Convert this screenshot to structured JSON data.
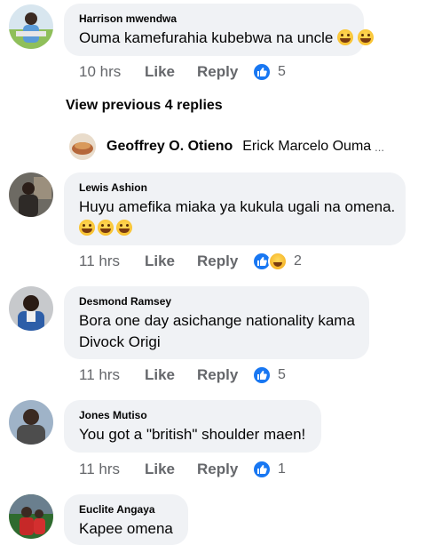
{
  "comments": [
    {
      "author": "Harrison mwendwa",
      "text": "Ouma kamefurahia kubebwa na uncle",
      "time": "10 hrs",
      "like": "Like",
      "reply": "Reply",
      "reactions": "5"
    },
    {
      "author": "Lewis Ashion",
      "text": "Huyu amefika miaka ya kukula ugali na omena.",
      "time": "11 hrs",
      "like": "Like",
      "reply": "Reply",
      "reactions": "2"
    },
    {
      "author": "Desmond Ramsey",
      "text_line1": "Bora one day asichange nationality kama",
      "text_line2": "Divock Origi",
      "time": "11 hrs",
      "like": "Like",
      "reply": "Reply",
      "reactions": "5"
    },
    {
      "author": "Jones Mutiso",
      "text": "You got a \"british\" shoulder maen!",
      "time": "11 hrs",
      "like": "Like",
      "reply": "Reply",
      "reactions": "1"
    },
    {
      "author": "Euclite Angaya",
      "text": "Kapee omena"
    }
  ],
  "view_previous": "View previous 4 replies",
  "reply_preview": {
    "author": "Geoffrey O. Otieno",
    "text": "Erick Marcelo Ouma",
    "ellipsis": "..."
  },
  "icons": {
    "like": "thumbs-up-icon",
    "haha": "haha-emoji-icon",
    "emoji": "laughing-emoji-icon"
  },
  "colors": {
    "accent": "#1877f2",
    "bubble": "#f0f2f5",
    "secondary_text": "#65676b"
  }
}
